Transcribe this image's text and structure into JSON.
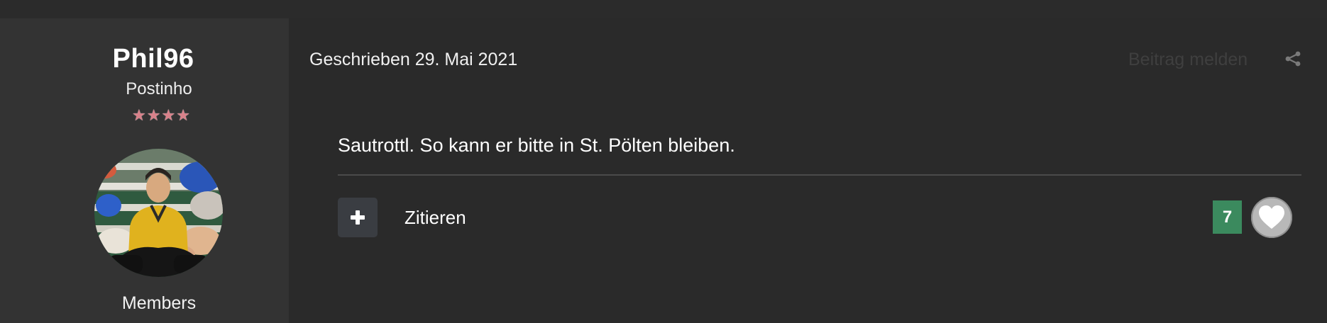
{
  "author": {
    "username": "Phil96",
    "rank": "Postinho",
    "stars": [
      "★",
      "★",
      "★",
      "★"
    ],
    "group": "Members"
  },
  "post": {
    "date_text": "Geschrieben 29. Mai 2021",
    "report_label": "Beitrag melden",
    "content": "Sautrottl. So kann er bitte in St. Pölten bleiben.",
    "quote_label": "Zitieren",
    "reaction_count": "7"
  },
  "icons": {
    "share": "share-icon",
    "multiquote": "plus-icon",
    "reaction": "heart-icon"
  },
  "colors": {
    "background": "#2b2b2b",
    "author_panel": "#333333",
    "reaction_count_bg": "#3b8a5e",
    "star_color": "#d9818a"
  }
}
